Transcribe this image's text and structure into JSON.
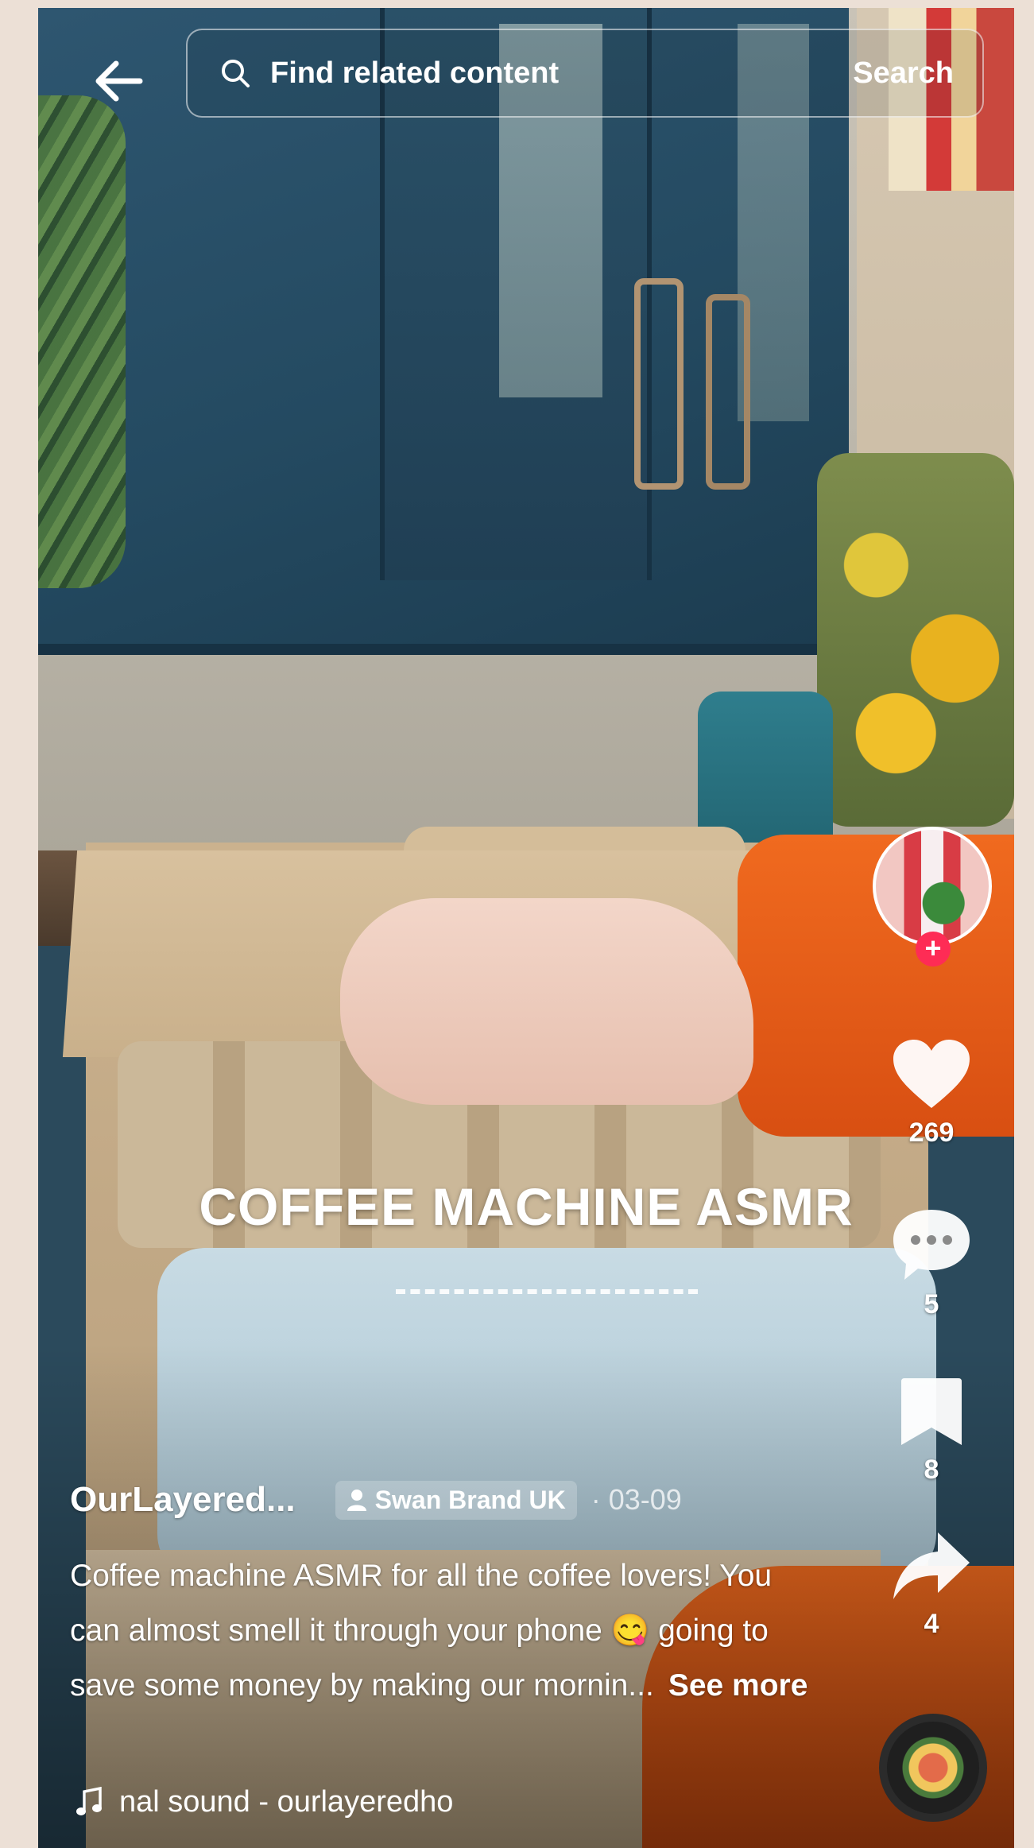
{
  "search": {
    "placeholder": "Find related content",
    "button_label": "Search"
  },
  "icons": {
    "back": "back-arrow-icon",
    "search": "search-icon",
    "like": "heart-icon",
    "comment": "comment-icon",
    "save": "bookmark-icon",
    "share": "share-icon",
    "music": "music-note-icon",
    "brand": "person-icon"
  },
  "video": {
    "overlay_text": "COFFEE MACHINE ASMR"
  },
  "actions": {
    "likes": "269",
    "comments": "5",
    "saves": "8",
    "shares": "4"
  },
  "post": {
    "author": "OurLayered...",
    "brand_tag": "Swan Brand UK",
    "date": "· 03-09",
    "caption": "Coffee machine ASMR for all the coffee lovers! You can almost smell it through your phone 😋 going to save some money by making our mornin...",
    "see_more": "See more",
    "sound": "nal sound - ourlayeredho"
  },
  "colors": {
    "follow_accent": "#fe2c55",
    "page_background": "#ece0d6"
  }
}
